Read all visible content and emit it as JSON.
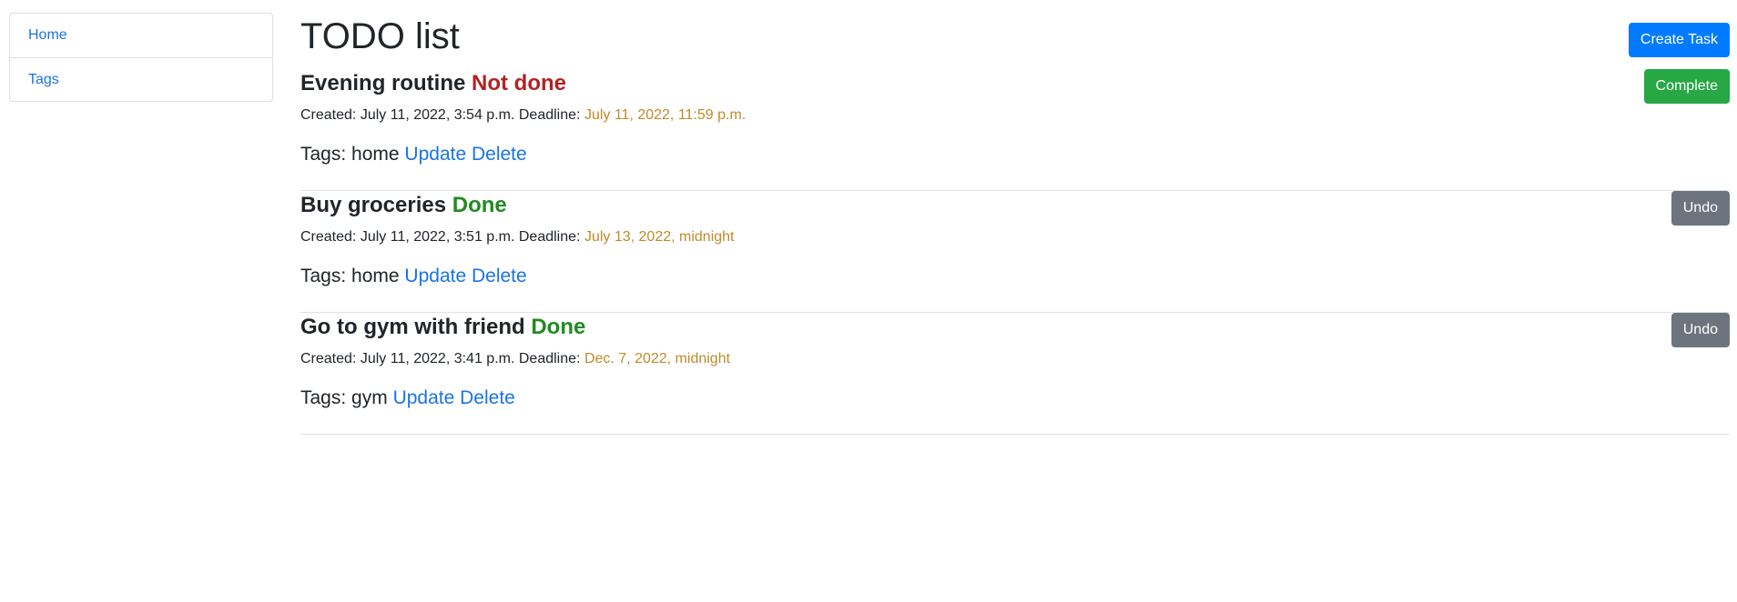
{
  "sidebar": {
    "items": [
      {
        "label": "Home"
      },
      {
        "label": "Tags"
      }
    ]
  },
  "header": {
    "title": "TODO list",
    "create_label": "Create Task"
  },
  "tasks": [
    {
      "title": "Evening routine",
      "status": "Not done",
      "created_label": "Created:",
      "created": "July 11, 2022, 3:54 p.m.",
      "deadline_label": "Deadline:",
      "deadline": "July 11, 2022, 11:59 p.m.",
      "tags_label": "Tags:",
      "tags": "home",
      "update_label": "Update",
      "delete_label": "Delete",
      "action_label": "Complete"
    },
    {
      "title": "Buy groceries",
      "status": "Done",
      "created_label": "Created:",
      "created": "July 11, 2022, 3:51 p.m.",
      "deadline_label": "Deadline:",
      "deadline": "July 13, 2022, midnight",
      "tags_label": "Tags:",
      "tags": "home",
      "update_label": "Update",
      "delete_label": "Delete",
      "action_label": "Undo"
    },
    {
      "title": "Go to gym with friend",
      "status": "Done",
      "created_label": "Created:",
      "created": "July 11, 2022, 3:41 p.m.",
      "deadline_label": "Deadline:",
      "deadline": "Dec. 7, 2022, midnight",
      "tags_label": "Tags:",
      "tags": "gym",
      "update_label": "Update",
      "delete_label": "Delete",
      "action_label": "Undo"
    }
  ],
  "colors": {
    "primary": "#007bff",
    "success": "#28a745",
    "secondary": "#6c757d",
    "link": "#1a73e8",
    "not_done": "#b22222",
    "done": "#228b22",
    "deadline": "#c08a2a"
  }
}
